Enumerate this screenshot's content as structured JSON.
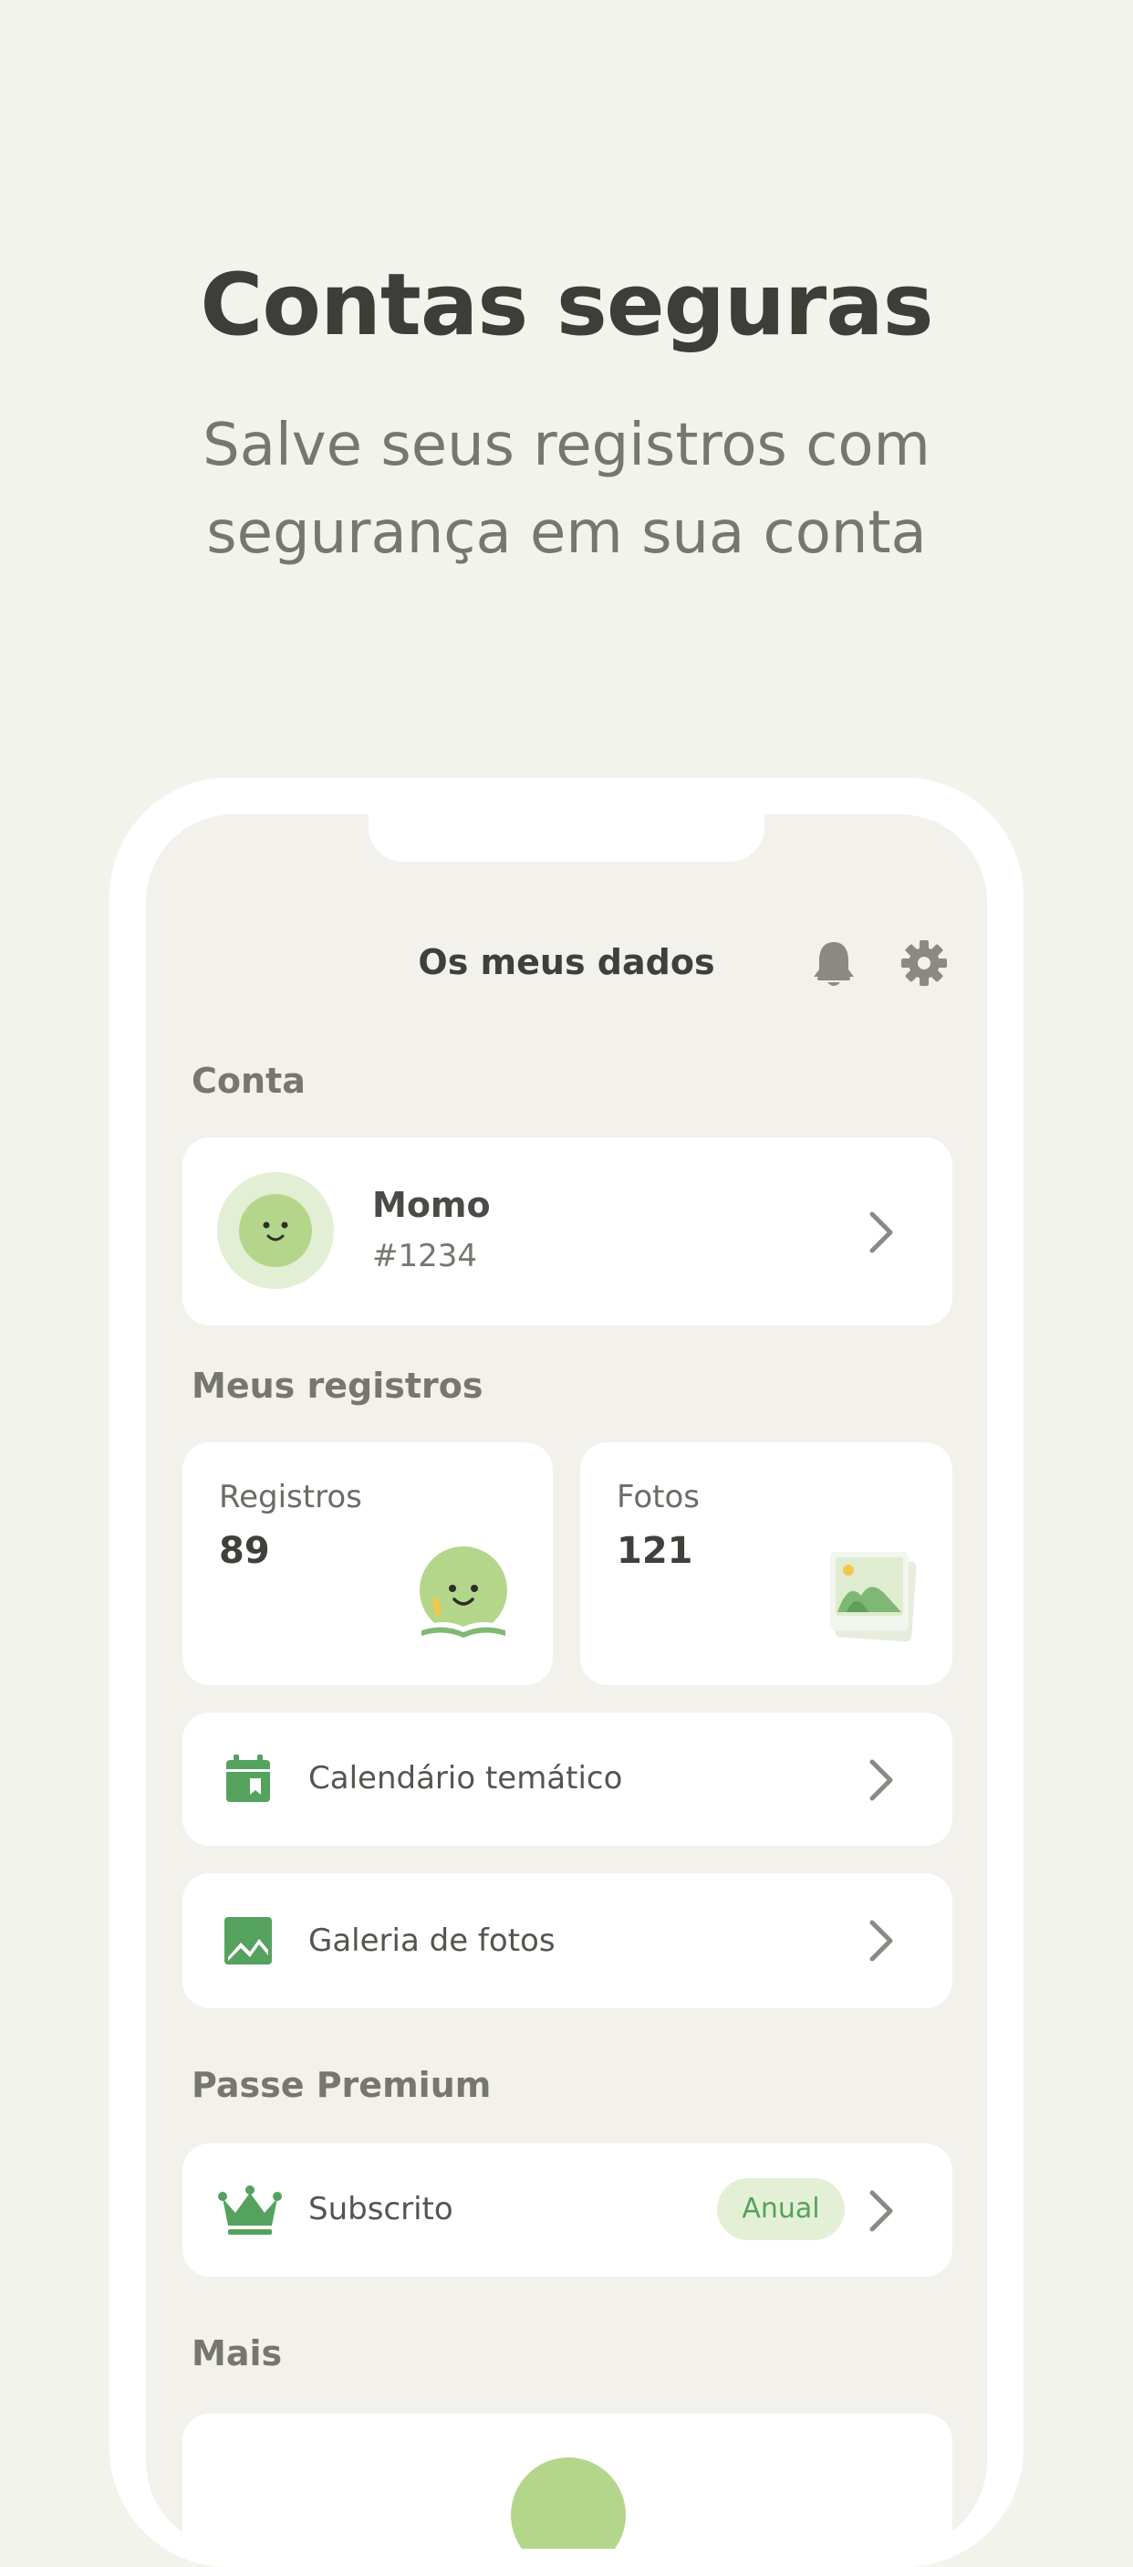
{
  "hero": {
    "title": "Contas seguras",
    "subtitle_line1": "Salve seus registros com",
    "subtitle_line2": "segurança em sua conta"
  },
  "app": {
    "title": "Os meus dados",
    "icons": [
      "bell-icon",
      "gear-icon"
    ]
  },
  "account": {
    "section_label": "Conta",
    "name": "Momo",
    "tag": "#1234"
  },
  "records": {
    "section_label": "Meus registros",
    "registros_label": "Registros",
    "registros_value": "89",
    "fotos_label": "Fotos",
    "fotos_value": "121"
  },
  "menu": {
    "calendar_label": "Calendário temático",
    "gallery_label": "Galeria de fotos"
  },
  "premium": {
    "section_label": "Passe Premium",
    "status_label": "Subscrito",
    "badge": "Anual"
  },
  "more": {
    "section_label": "Mais"
  },
  "colors": {
    "background": "#f2f4ec",
    "accent_green": "#55a25e",
    "light_green": "#b4d68b",
    "badge_bg": "#e3f0d6"
  }
}
